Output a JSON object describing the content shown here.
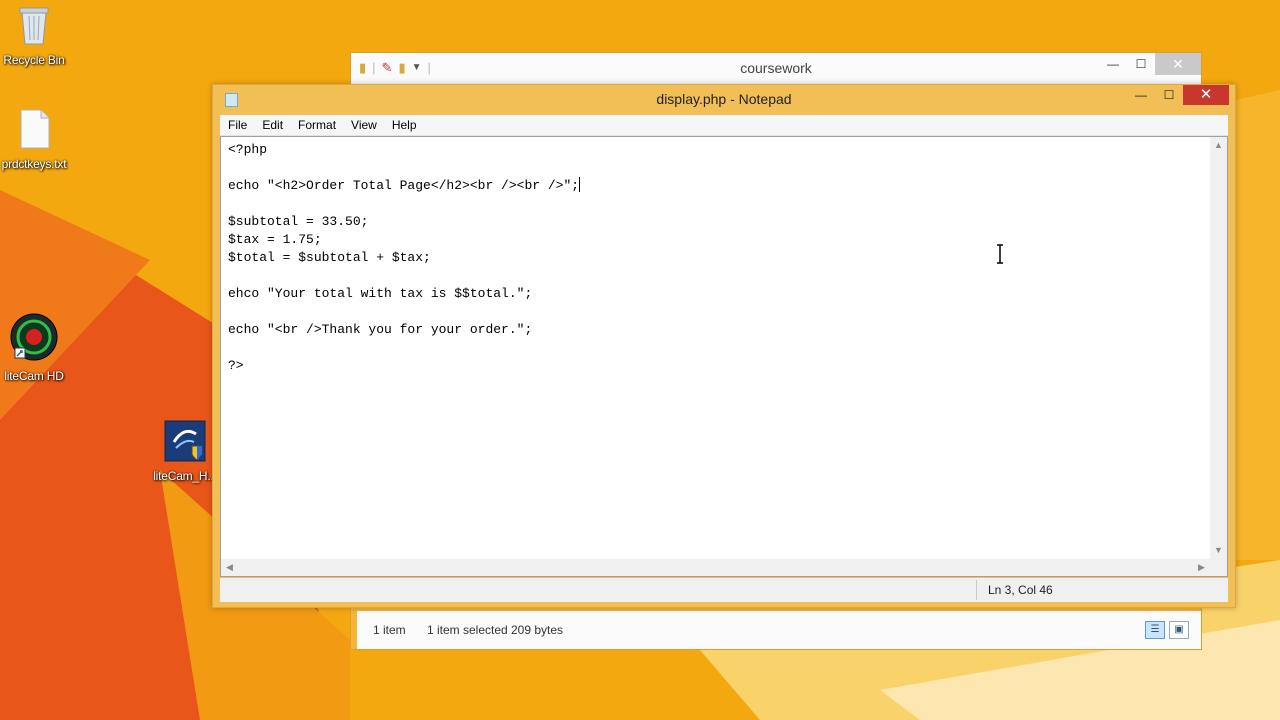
{
  "desktop": {
    "icons": [
      {
        "label": "Recycle Bin",
        "icon": "recycle-bin-icon"
      },
      {
        "label": "prdctkeys.txt",
        "icon": "text-file-icon"
      },
      {
        "label": "liteCam HD",
        "icon": "litecam-icon"
      },
      {
        "label": "liteCam_H...",
        "icon": "installer-shield-icon"
      }
    ]
  },
  "explorer": {
    "title": "coursework",
    "status": {
      "items": "1 item",
      "selected": "1 item selected",
      "size": "209 bytes"
    }
  },
  "notepad": {
    "title": "display.php - Notepad",
    "menu": [
      "File",
      "Edit",
      "Format",
      "View",
      "Help"
    ],
    "lines": [
      "<?php",
      "",
      "echo \"<h2>Order Total Page</h2><br /><br />\";",
      "",
      "$subtotal = 33.50;",
      "$tax = 1.75;",
      "$total = $subtotal + $tax;",
      "",
      "ehco \"Your total with tax is $$total.\";",
      "",
      "echo \"<br />Thank you for your order.\";",
      "",
      "?>"
    ],
    "status_position": "Ln 3, Col 46"
  },
  "colors": {
    "desktop": "#f4a810",
    "notepad_frame": "#f2bf57",
    "close_button": "#c7372d"
  }
}
